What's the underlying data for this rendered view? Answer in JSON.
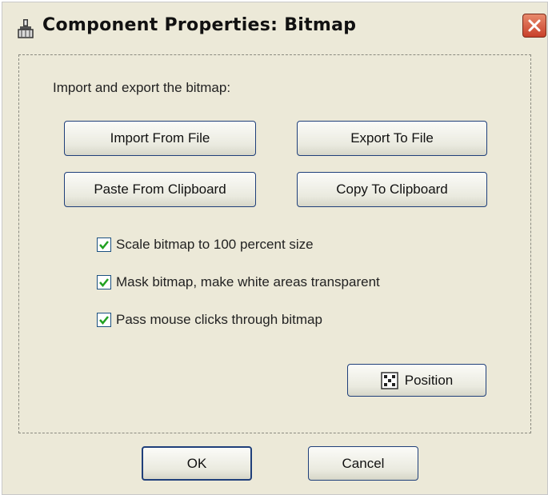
{
  "window": {
    "title": "Component Properties: Bitmap",
    "title_icon": "brush-icon",
    "close_icon": "close-icon"
  },
  "intro_text": "Import and export the bitmap:",
  "buttons": {
    "import_from_file": "Import From File",
    "export_to_file": "Export To File",
    "paste_from_clipboard": "Paste From Clipboard",
    "copy_to_clipboard": "Copy To Clipboard",
    "position": "Position",
    "ok": "OK",
    "cancel": "Cancel"
  },
  "checkboxes": [
    {
      "label": "Scale bitmap to 100 percent size",
      "checked": true
    },
    {
      "label": "Mask bitmap, make white areas transparent",
      "checked": true
    },
    {
      "label": "Pass mouse clicks through bitmap",
      "checked": true
    }
  ],
  "colors": {
    "dialog_bg": "#ece9d8",
    "button_border": "#1f3f7a",
    "check_green": "#21a121",
    "close_red": "#c8402a"
  }
}
